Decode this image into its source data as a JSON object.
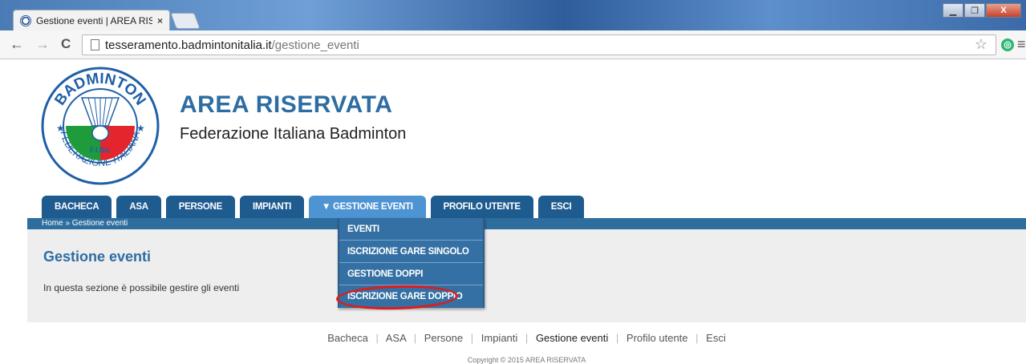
{
  "browser": {
    "tab_title": "Gestione eventi | AREA RIS",
    "tab_close": "×",
    "url_host": "tesseramento.badmintonitalia.it",
    "url_path": "/gestione_eventi",
    "back": "←",
    "forward": "→",
    "reload": "C",
    "star": "☆",
    "ext": "◎",
    "menu": "≡",
    "win_min": "▁",
    "win_max": "❐",
    "win_close": "X"
  },
  "header": {
    "title": "AREA RISERVATA",
    "subtitle": "Federazione Italiana Badminton",
    "logo": {
      "top_text": "BADMINTON",
      "bottom_text": "FEDERAZIONE ITALIANA",
      "center_text": "F.I.Ba.",
      "colors": {
        "ring": "#1f5fa8",
        "green": "#1e9c3c",
        "red": "#e3262e"
      }
    }
  },
  "nav": {
    "tabs": [
      {
        "label": "BACHECA"
      },
      {
        "label": "ASA"
      },
      {
        "label": "PERSONE"
      },
      {
        "label": "IMPIANTI"
      },
      {
        "label": "▼ GESTIONE EVENTI"
      },
      {
        "label": "PROFILO UTENTE"
      },
      {
        "label": "ESCI"
      }
    ],
    "dropdown": [
      {
        "label": "EVENTI"
      },
      {
        "label": "ISCRIZIONE GARE SINGOLO"
      },
      {
        "label": "GESTIONE DOPPI"
      },
      {
        "label": "ISCRIZIONE GARE DOPPIO"
      }
    ]
  },
  "breadcrumb": "Home » Gestione eventi",
  "main": {
    "title": "Gestione eventi",
    "text": "In questa sezione è possibile gestire gli eventi"
  },
  "footer": {
    "links": [
      "Bacheca",
      "ASA",
      "Persone",
      "Impianti",
      "Gestione eventi",
      "Profilo utente",
      "Esci"
    ],
    "separator": "|",
    "copyright": "Copyright © 2015 AREA RISERVATA"
  },
  "colors": {
    "nav_tab": "#1e5b8f",
    "nav_tab_active": "#4e93d2",
    "title_blue": "#2d6da3",
    "highlight_red": "#e01b1b"
  }
}
